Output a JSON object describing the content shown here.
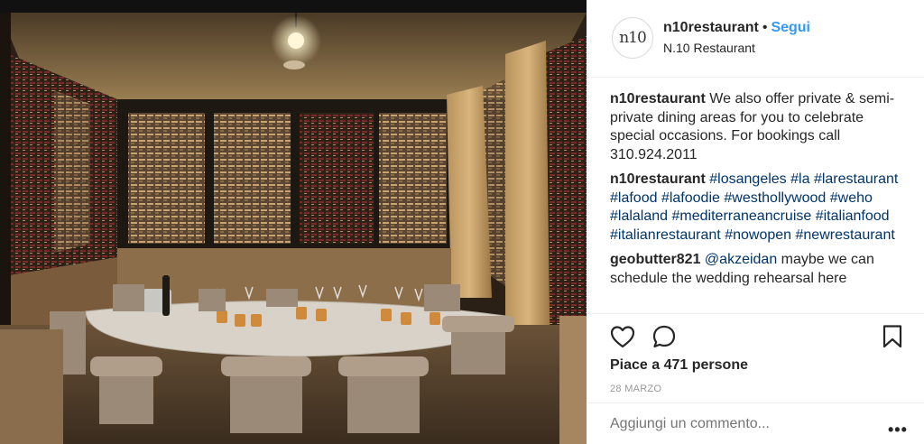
{
  "post": {
    "image_alt": "Private dining room with wine walls, marble table and armchairs",
    "header": {
      "username": "n10restaurant",
      "separator": "•",
      "follow_label": "Segui",
      "location": "N.10 Restaurant",
      "avatar_text": "n10"
    },
    "comments": [
      {
        "user": "n10restaurant",
        "text": "We also offer private & semi-private dining areas for you to celebrate special occasions. For bookings call 310.924.2011"
      },
      {
        "user": "n10restaurant",
        "hashtags": [
          "#losangeles",
          "#la",
          "#larestaurant",
          "#lafood",
          "#lafoodie",
          "#westhollywood",
          "#weho",
          "#lalaland",
          "#mediterraneancruise",
          "#italianfood",
          "#italianrestaurant",
          "#nowopen",
          "#newrestaurant"
        ]
      },
      {
        "user": "geobutter821",
        "mention": "@akzeidan",
        "text": "maybe we can schedule the wedding rehearsal here"
      }
    ],
    "likes_text": "Piace a 471 persone",
    "date": "28 MARZO",
    "add_comment_placeholder": "Aggiungi un commento...",
    "icons": {
      "like": "heart-icon",
      "comment": "comment-bubble-icon",
      "save": "bookmark-icon",
      "more": "more-options-icon"
    },
    "colors": {
      "link_blue": "#3897f0",
      "hashtag": "#003569",
      "muted": "#999999",
      "text": "#262626"
    }
  }
}
